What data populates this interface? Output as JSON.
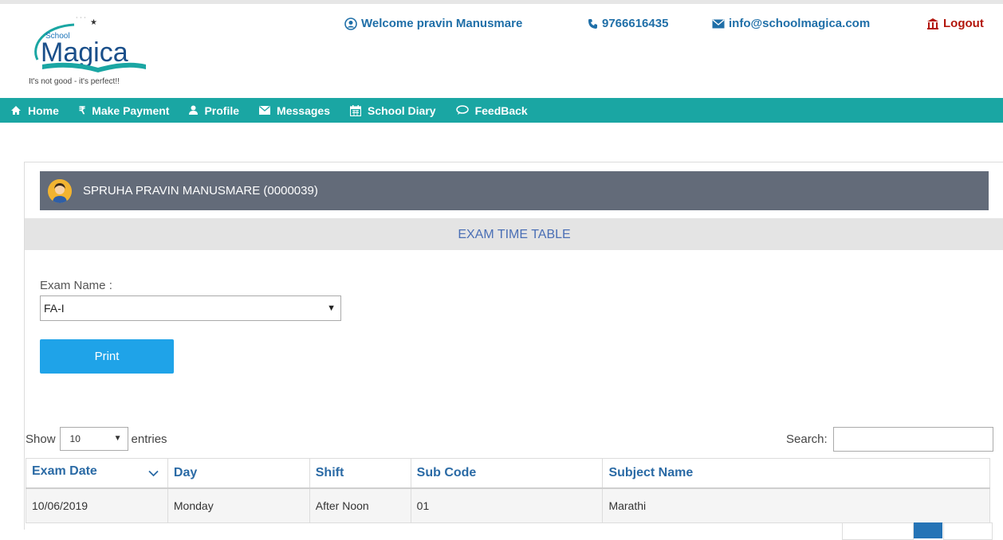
{
  "header": {
    "logo_small": "School",
    "logo_text": "Magica",
    "tagline": "It's not good - it's perfect!!",
    "welcome": "Welcome pravin Manusmare",
    "phone": "9766616435",
    "email": "info@schoolmagica.com",
    "logout": "Logout"
  },
  "nav": {
    "items": [
      {
        "label": "Home",
        "icon": "home-icon"
      },
      {
        "label": "Make Payment",
        "icon": "rupee-icon"
      },
      {
        "label": "Profile",
        "icon": "user-icon"
      },
      {
        "label": "Messages",
        "icon": "envelope-icon"
      },
      {
        "label": "School Diary",
        "icon": "calendar-icon"
      },
      {
        "label": "FeedBack",
        "icon": "chat-icon"
      }
    ]
  },
  "student": {
    "name": "SPRUHA PRAVIN MANUSMARE (0000039)"
  },
  "section": {
    "title": "EXAM TIME TABLE"
  },
  "form": {
    "exam_label": "Exam Name :",
    "exam_value": "FA-I",
    "print_label": "Print"
  },
  "table": {
    "show_label": "Show",
    "entries_value": "10",
    "entries_label": "entries",
    "search_label": "Search:",
    "columns": [
      "Exam Date",
      "Day",
      "Shift",
      "Sub Code",
      "Subject Name"
    ],
    "rows": [
      [
        "10/06/2019",
        "Monday",
        "After Noon",
        "01",
        "Marathi"
      ]
    ]
  },
  "colors": {
    "nav_bg": "#1aa6a3",
    "student_bar": "#636b79",
    "print_button": "#1fa3e8",
    "header_link": "#1f6fa8",
    "logout": "#b3170d"
  }
}
